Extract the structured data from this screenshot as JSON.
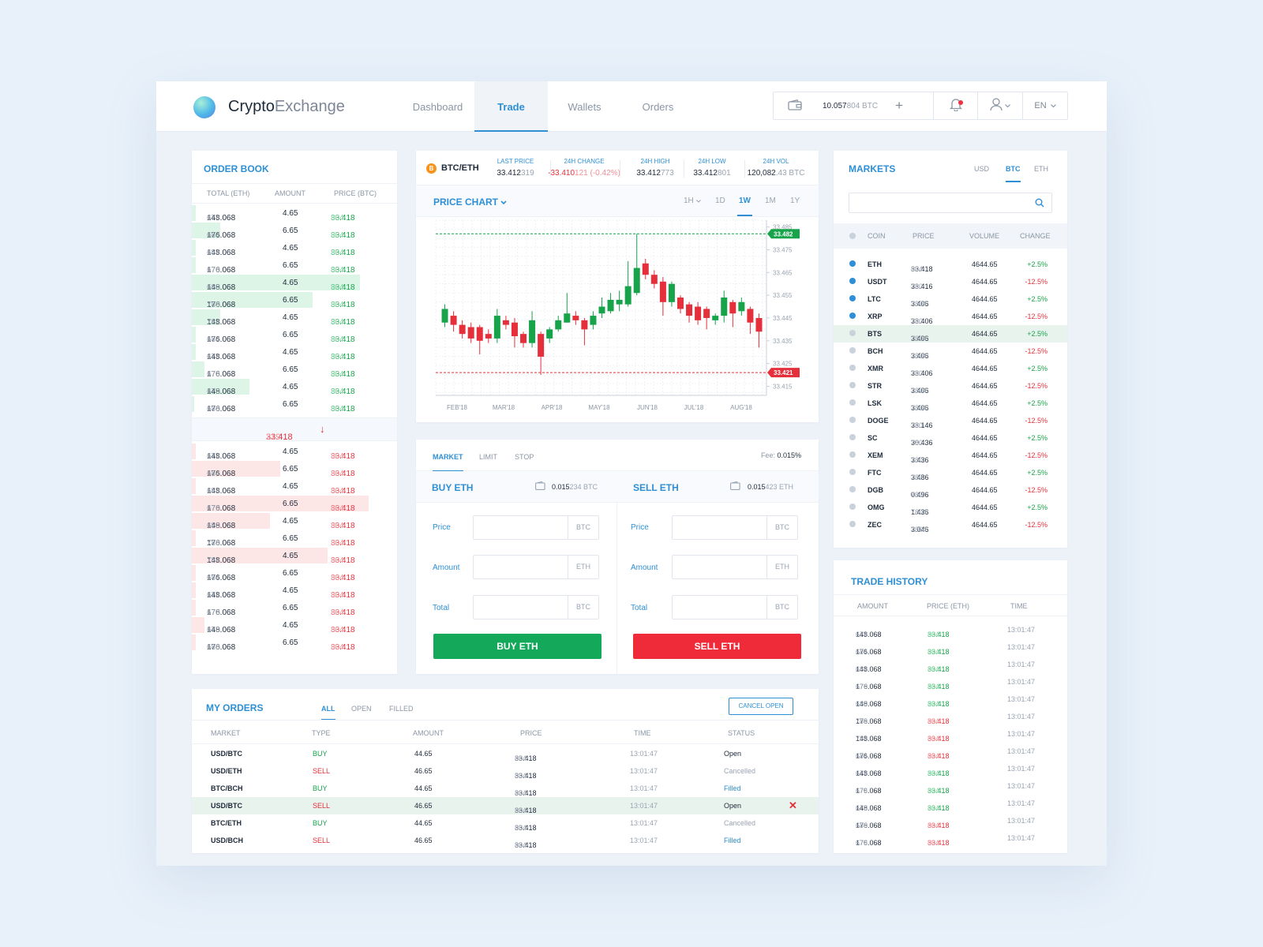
{
  "brand": {
    "name_main": "Crypto",
    "name_sub": "Exchange"
  },
  "nav": [
    {
      "label": "Dashboard",
      "active": false
    },
    {
      "label": "Trade",
      "active": true
    },
    {
      "label": "Wallets",
      "active": false
    },
    {
      "label": "Orders",
      "active": false
    }
  ],
  "wallet": {
    "balance_main": "10.057",
    "balance_tail": "804 BTC",
    "add": "+"
  },
  "lang": "EN",
  "colors": {
    "accent": "#2e8fd4",
    "buy": "#16a34a",
    "sell": "#e5303c",
    "background": "#edf2f9"
  },
  "icons": [
    "wallet-icon",
    "plus-icon",
    "bell-icon",
    "user-icon",
    "chevron-down-icon",
    "search-icon",
    "close-icon",
    "bitcoin-icon",
    "arrow-down-icon"
  ],
  "order_book": {
    "title": "ORDER BOOK",
    "headers": [
      "TOTAL (ETH)",
      "AMOUNT",
      "PRICE (BTC)"
    ],
    "buy_rows": [
      {
        "total_main": "148.068",
        "total_tail": "674",
        "amount": "4.65",
        "price_main": "33.418",
        "price_tail": "804",
        "depth": 0.02
      },
      {
        "total_main": "176.068",
        "total_tail": "684",
        "amount": "6.65",
        "price_main": "33.418",
        "price_tail": "804",
        "depth": 0.14
      },
      {
        "total_main": "148.068",
        "total_tail": "684",
        "amount": "4.65",
        "price_main": "33.418",
        "price_tail": "804",
        "depth": 0.02
      },
      {
        "total_main": "176.068",
        "total_tail": "670",
        "amount": "6.65",
        "price_main": "33.418",
        "price_tail": "804",
        "depth": 0.02
      },
      {
        "total_main": "148.068",
        "total_tail": "680",
        "amount": "4.65",
        "price_main": "33.418",
        "price_tail": "804",
        "depth": 0.82
      },
      {
        "total_main": "176.068",
        "total_tail": "780",
        "amount": "6.65",
        "price_main": "33.418",
        "price_tail": "804",
        "depth": 0.59
      },
      {
        "total_main": "148.068",
        "total_tail": "784",
        "amount": "4.65",
        "price_main": "33.418",
        "price_tail": "804",
        "depth": 0.14
      },
      {
        "total_main": "176.068",
        "total_tail": "684",
        "amount": "6.65",
        "price_main": "33.418",
        "price_tail": "804",
        "depth": 0.02
      },
      {
        "total_main": "148.068",
        "total_tail": "674",
        "amount": "4.65",
        "price_main": "33.418",
        "price_tail": "804",
        "depth": 0.02
      },
      {
        "total_main": "176.068",
        "total_tail": "678",
        "amount": "6.65",
        "price_main": "33.418",
        "price_tail": "804",
        "depth": 0.06
      },
      {
        "total_main": "148.068",
        "total_tail": "670",
        "amount": "4.65",
        "price_main": "33.418",
        "price_tail": "804",
        "depth": 0.28
      },
      {
        "total_main": "176.068",
        "total_tail": "680",
        "amount": "6.65",
        "price_main": "33.418",
        "price_tail": "804",
        "depth": 0.0
      }
    ],
    "mid_price_main": "33.418",
    "mid_price_tail": "219",
    "mid_arrow": "↓",
    "sell_rows": [
      {
        "total_main": "148.068",
        "total_tail": "674",
        "amount": "4.65",
        "price_main": "33.418",
        "price_tail": "804",
        "depth": 0.02
      },
      {
        "total_main": "176.068",
        "total_tail": "684",
        "amount": "6.65",
        "price_main": "33.418",
        "price_tail": "804",
        "depth": 0.43
      },
      {
        "total_main": "148.068",
        "total_tail": "684",
        "amount": "4.65",
        "price_main": "33.418",
        "price_tail": "804",
        "depth": 0.02
      },
      {
        "total_main": "176.068",
        "total_tail": "670",
        "amount": "6.65",
        "price_main": "33.418",
        "price_tail": "804",
        "depth": 0.86
      },
      {
        "total_main": "148.068",
        "total_tail": "680",
        "amount": "4.65",
        "price_main": "33.418",
        "price_tail": "804",
        "depth": 0.38
      },
      {
        "total_main": "176.068",
        "total_tail": "780",
        "amount": "6.65",
        "price_main": "33.418",
        "price_tail": "804",
        "depth": 0.02
      },
      {
        "total_main": "148.068",
        "total_tail": "784",
        "amount": "4.65",
        "price_main": "33.418",
        "price_tail": "804",
        "depth": 0.66
      },
      {
        "total_main": "176.068",
        "total_tail": "684",
        "amount": "6.65",
        "price_main": "33.418",
        "price_tail": "804",
        "depth": 0.02
      },
      {
        "total_main": "148.068",
        "total_tail": "674",
        "amount": "4.65",
        "price_main": "33.418",
        "price_tail": "804",
        "depth": 0.02
      },
      {
        "total_main": "176.068",
        "total_tail": "678",
        "amount": "6.65",
        "price_main": "33.418",
        "price_tail": "804",
        "depth": 0.02
      },
      {
        "total_main": "148.068",
        "total_tail": "670",
        "amount": "4.65",
        "price_main": "33.418",
        "price_tail": "804",
        "depth": 0.06
      },
      {
        "total_main": "176.068",
        "total_tail": "680",
        "amount": "6.65",
        "price_main": "33.418",
        "price_tail": "804",
        "depth": 0.02
      }
    ]
  },
  "ticker": {
    "pair": "BTC/ETH",
    "coin_symbol": "B",
    "stats": [
      {
        "label": "LAST PRICE",
        "main": "33.412",
        "tail": "319",
        "tone": "normal"
      },
      {
        "label": "24H CHANGE",
        "main": "-33.410",
        "tail": "121 (-0.42%)",
        "tone": "red"
      },
      {
        "label": "24H HIGH",
        "main": "33.412",
        "tail": "773",
        "tone": "normal"
      },
      {
        "label": "24H LOW",
        "main": "33.412",
        "tail": "801",
        "tone": "normal"
      },
      {
        "label": "24H VOL",
        "main": "120,082",
        "tail": ".43 BTC",
        "tone": "normal"
      }
    ]
  },
  "price_chart": {
    "title": "PRICE CHART",
    "timeframes": [
      {
        "label": "1H",
        "active": false
      },
      {
        "label": "1D",
        "active": false
      },
      {
        "label": "1W",
        "active": true
      },
      {
        "label": "1M",
        "active": false
      },
      {
        "label": "1Y",
        "active": false
      }
    ]
  },
  "chart_data": {
    "type": "candlestick",
    "x_labels": [
      "FEB'18",
      "MAR'18",
      "APR'18",
      "MAY'18",
      "JUN'18",
      "JUL'18",
      "AUG'18"
    ],
    "y_ticks": [
      33.485,
      33.475,
      33.465,
      33.455,
      33.445,
      33.435,
      33.425,
      33.415
    ],
    "ylim": [
      33.411,
      33.488
    ],
    "high_marker": 33.482,
    "low_marker": 33.421,
    "grid": true,
    "candles": [
      {
        "o": 33.443,
        "c": 33.449,
        "h": 33.451,
        "l": 33.441
      },
      {
        "o": 33.446,
        "c": 33.442,
        "h": 33.448,
        "l": 33.439
      },
      {
        "o": 33.442,
        "c": 33.438,
        "h": 33.444,
        "l": 33.436
      },
      {
        "o": 33.441,
        "c": 33.436,
        "h": 33.443,
        "l": 33.434
      },
      {
        "o": 33.441,
        "c": 33.435,
        "h": 33.442,
        "l": 33.429
      },
      {
        "o": 33.438,
        "c": 33.436,
        "h": 33.44,
        "l": 33.434
      },
      {
        "o": 33.436,
        "c": 33.446,
        "h": 33.449,
        "l": 33.434
      },
      {
        "o": 33.444,
        "c": 33.442,
        "h": 33.446,
        "l": 33.44
      },
      {
        "o": 33.443,
        "c": 33.437,
        "h": 33.445,
        "l": 33.432
      },
      {
        "o": 33.438,
        "c": 33.434,
        "h": 33.439,
        "l": 33.432
      },
      {
        "o": 33.434,
        "c": 33.444,
        "h": 33.448,
        "l": 33.432
      },
      {
        "o": 33.438,
        "c": 33.428,
        "h": 33.439,
        "l": 33.42
      },
      {
        "o": 33.436,
        "c": 33.44,
        "h": 33.441,
        "l": 33.434
      },
      {
        "o": 33.44,
        "c": 33.444,
        "h": 33.446,
        "l": 33.439
      },
      {
        "o": 33.443,
        "c": 33.447,
        "h": 33.456,
        "l": 33.443
      },
      {
        "o": 33.446,
        "c": 33.444,
        "h": 33.448,
        "l": 33.442
      },
      {
        "o": 33.444,
        "c": 33.44,
        "h": 33.445,
        "l": 33.433
      },
      {
        "o": 33.442,
        "c": 33.446,
        "h": 33.448,
        "l": 33.44
      },
      {
        "o": 33.447,
        "c": 33.45,
        "h": 33.454,
        "l": 33.445
      },
      {
        "o": 33.448,
        "c": 33.453,
        "h": 33.456,
        "l": 33.447
      },
      {
        "o": 33.451,
        "c": 33.453,
        "h": 33.457,
        "l": 33.448
      },
      {
        "o": 33.451,
        "c": 33.459,
        "h": 33.47,
        "l": 33.45
      },
      {
        "o": 33.456,
        "c": 33.467,
        "h": 33.482,
        "l": 33.455
      },
      {
        "o": 33.469,
        "c": 33.464,
        "h": 33.471,
        "l": 33.462
      },
      {
        "o": 33.464,
        "c": 33.46,
        "h": 33.466,
        "l": 33.458
      },
      {
        "o": 33.461,
        "c": 33.452,
        "h": 33.463,
        "l": 33.446
      },
      {
        "o": 33.452,
        "c": 33.46,
        "h": 33.461,
        "l": 33.45
      },
      {
        "o": 33.454,
        "c": 33.449,
        "h": 33.455,
        "l": 33.447
      },
      {
        "o": 33.451,
        "c": 33.446,
        "h": 33.452,
        "l": 33.443
      },
      {
        "o": 33.45,
        "c": 33.444,
        "h": 33.452,
        "l": 33.442
      },
      {
        "o": 33.449,
        "c": 33.445,
        "h": 33.45,
        "l": 33.44
      },
      {
        "o": 33.444,
        "c": 33.446,
        "h": 33.447,
        "l": 33.442
      },
      {
        "o": 33.446,
        "c": 33.454,
        "h": 33.457,
        "l": 33.443
      },
      {
        "o": 33.452,
        "c": 33.447,
        "h": 33.453,
        "l": 33.441
      },
      {
        "o": 33.448,
        "c": 33.452,
        "h": 33.454,
        "l": 33.446
      },
      {
        "o": 33.449,
        "c": 33.443,
        "h": 33.45,
        "l": 33.438
      },
      {
        "o": 33.445,
        "c": 33.439,
        "h": 33.447,
        "l": 33.432
      }
    ]
  },
  "trade": {
    "tabs": [
      {
        "label": "MARKET",
        "active": true
      },
      {
        "label": "LIMIT",
        "active": false
      },
      {
        "label": "STOP",
        "active": false
      }
    ],
    "fee_label": "Fee:",
    "fee_value": "0.015%",
    "buy": {
      "title": "BUY ETH",
      "bal_main": "0.015",
      "bal_tail": "234 BTC",
      "button": "BUY ETH"
    },
    "sell": {
      "title": "SELL ETH",
      "bal_main": "0.015",
      "bal_tail": "423 ETH",
      "button": "SELL ETH"
    },
    "fields": [
      {
        "label": "Price",
        "buy_unit": "BTC",
        "sell_unit": "BTC"
      },
      {
        "label": "Amount",
        "buy_unit": "ETH",
        "sell_unit": "ETH"
      },
      {
        "label": "Total",
        "buy_unit": "BTC",
        "sell_unit": "BTC"
      }
    ]
  },
  "markets": {
    "title": "MARKETS",
    "tabs": [
      {
        "label": "USD",
        "active": false
      },
      {
        "label": "BTC",
        "active": true
      },
      {
        "label": "ETH",
        "active": false
      }
    ],
    "headers": [
      "COIN",
      "PRICE",
      "VOLUME",
      "CHANGE"
    ],
    "rows": [
      {
        "coin": "ETH",
        "price_main": "33.418",
        "price_tail": "804",
        "volume": "4644.65",
        "change": "+2.5%",
        "starred": true,
        "hl": false
      },
      {
        "coin": "USDT",
        "price_main": "33.416",
        "price_tail": "780",
        "volume": "4644.65",
        "change": "-12.5%",
        "starred": true,
        "hl": false
      },
      {
        "coin": "LTC",
        "price_main": "3.406",
        "price_tail": "7804",
        "volume": "4644.65",
        "change": "+2.5%",
        "starred": true,
        "hl": false
      },
      {
        "coin": "XRP",
        "price_main": "33.406",
        "price_tail": "780",
        "volume": "4644.65",
        "change": "-12.5%",
        "starred": true,
        "hl": false
      },
      {
        "coin": "BTS",
        "price_main": "3.406",
        "price_tail": "7804",
        "volume": "4644.65",
        "change": "+2.5%",
        "starred": false,
        "hl": true
      },
      {
        "coin": "BCH",
        "price_main": "3.406",
        "price_tail": "7804",
        "volume": "4644.65",
        "change": "-12.5%",
        "starred": false,
        "hl": false
      },
      {
        "coin": "XMR",
        "price_main": "33.406",
        "price_tail": "780",
        "volume": "4644.65",
        "change": "+2.5%",
        "starred": false,
        "hl": false
      },
      {
        "coin": "STR",
        "price_main": "3.406",
        "price_tail": "7804",
        "volume": "4644.65",
        "change": "-12.5%",
        "starred": false,
        "hl": false
      },
      {
        "coin": "LSK",
        "price_main": "3.406",
        "price_tail": "7804",
        "volume": "4644.65",
        "change": "+2.5%",
        "starred": false,
        "hl": false
      },
      {
        "coin": "DOGE",
        "price_main": "33.146",
        "price_tail": "780",
        "volume": "4644.65",
        "change": "-12.5%",
        "starred": false,
        "hl": false
      },
      {
        "coin": "SC",
        "price_main": "30.436",
        "price_tail": "780",
        "volume": "4644.65",
        "change": "+2.5%",
        "starred": false,
        "hl": false
      },
      {
        "coin": "XEM",
        "price_main": "3.436",
        "price_tail": "780",
        "volume": "4644.65",
        "change": "-12.5%",
        "starred": false,
        "hl": false
      },
      {
        "coin": "FTC",
        "price_main": "3.486",
        "price_tail": "780",
        "volume": "4644.65",
        "change": "+2.5%",
        "starred": false,
        "hl": false
      },
      {
        "coin": "DGB",
        "price_main": "0.496",
        "price_tail": "780",
        "volume": "4644.65",
        "change": "-12.5%",
        "starred": false,
        "hl": false
      },
      {
        "coin": "OMG",
        "price_main": "1.436",
        "price_tail": "7804",
        "volume": "4644.65",
        "change": "+2.5%",
        "starred": false,
        "hl": false
      },
      {
        "coin": "ZEC",
        "price_main": "3.046",
        "price_tail": "7804",
        "volume": "4644.65",
        "change": "-12.5%",
        "starred": false,
        "hl": false
      }
    ]
  },
  "trade_history": {
    "title": "TRADE HISTORY",
    "headers": [
      "AMOUNT",
      "PRICE (ETH)",
      "TIME"
    ],
    "rows": [
      {
        "amount_main": "148.068",
        "amount_tail": "674",
        "price_main": "33.418",
        "price_tail": "804",
        "side": "buy",
        "time": "13:01:47"
      },
      {
        "amount_main": "176.068",
        "amount_tail": "684",
        "price_main": "33.418",
        "price_tail": "804",
        "side": "buy",
        "time": "13:01:47"
      },
      {
        "amount_main": "148.068",
        "amount_tail": "684",
        "price_main": "33.418",
        "price_tail": "804",
        "side": "buy",
        "time": "13:01:47"
      },
      {
        "amount_main": "176.068",
        "amount_tail": "670",
        "price_main": "33.418",
        "price_tail": "804",
        "side": "buy",
        "time": "13:01:47"
      },
      {
        "amount_main": "148.068",
        "amount_tail": "680",
        "price_main": "33.418",
        "price_tail": "804",
        "side": "buy",
        "time": "13:01:47"
      },
      {
        "amount_main": "176.068",
        "amount_tail": "780",
        "price_main": "33.418",
        "price_tail": "804",
        "side": "sell",
        "time": "13:01:47"
      },
      {
        "amount_main": "148.068",
        "amount_tail": "784",
        "price_main": "33.418",
        "price_tail": "804",
        "side": "sell",
        "time": "13:01:47"
      },
      {
        "amount_main": "176.068",
        "amount_tail": "684",
        "price_main": "33.418",
        "price_tail": "804",
        "side": "sell",
        "time": "13:01:47"
      },
      {
        "amount_main": "148.068",
        "amount_tail": "674",
        "price_main": "33.418",
        "price_tail": "804",
        "side": "buy",
        "time": "13:01:47"
      },
      {
        "amount_main": "176.068",
        "amount_tail": "678",
        "price_main": "33.418",
        "price_tail": "804",
        "side": "buy",
        "time": "13:01:47"
      },
      {
        "amount_main": "148.068",
        "amount_tail": "670",
        "price_main": "33.418",
        "price_tail": "804",
        "side": "buy",
        "time": "13:01:47"
      },
      {
        "amount_main": "176.068",
        "amount_tail": "680",
        "price_main": "33.418",
        "price_tail": "804",
        "side": "sell",
        "time": "13:01:47"
      },
      {
        "amount_main": "176.068",
        "amount_tail": "678",
        "price_main": "33.418",
        "price_tail": "804",
        "side": "sell",
        "time": "13:01:47"
      }
    ]
  },
  "my_orders": {
    "title": "MY ORDERS",
    "tabs": [
      {
        "label": "ALL",
        "active": true
      },
      {
        "label": "OPEN",
        "active": false
      },
      {
        "label": "FILLED",
        "active": false
      }
    ],
    "cancel_open": "CANCEL OPEN",
    "headers": [
      "MARKET",
      "TYPE",
      "AMOUNT",
      "PRICE",
      "TIME",
      "STATUS"
    ],
    "rows": [
      {
        "market": "USD/BTC",
        "type": "BUY",
        "amount": "44.65",
        "price_main": "33.418",
        "price_tail": "804",
        "time": "13:01:47",
        "status": "Open",
        "hl": false,
        "cancel": false
      },
      {
        "market": "USD/ETH",
        "type": "SELL",
        "amount": "46.65",
        "price_main": "33.418",
        "price_tail": "804",
        "time": "13:01:47",
        "status": "Cancelled",
        "hl": false,
        "cancel": false
      },
      {
        "market": "BTC/BCH",
        "type": "BUY",
        "amount": "44.65",
        "price_main": "33.418",
        "price_tail": "804",
        "time": "13:01:47",
        "status": "Filled",
        "hl": false,
        "cancel": false
      },
      {
        "market": "USD/BTC",
        "type": "SELL",
        "amount": "46.65",
        "price_main": "33.418",
        "price_tail": "804",
        "time": "13:01:47",
        "status": "Open",
        "hl": true,
        "cancel": true,
        "cancel_symbol": "✕"
      },
      {
        "market": "BTC/ETH",
        "type": "BUY",
        "amount": "44.65",
        "price_main": "33.418",
        "price_tail": "804",
        "time": "13:01:47",
        "status": "Cancelled",
        "hl": false,
        "cancel": false
      },
      {
        "market": "USD/BCH",
        "type": "SELL",
        "amount": "46.65",
        "price_main": "33.418",
        "price_tail": "804",
        "time": "13:01:47",
        "status": "Filled",
        "hl": false,
        "cancel": false
      }
    ]
  }
}
